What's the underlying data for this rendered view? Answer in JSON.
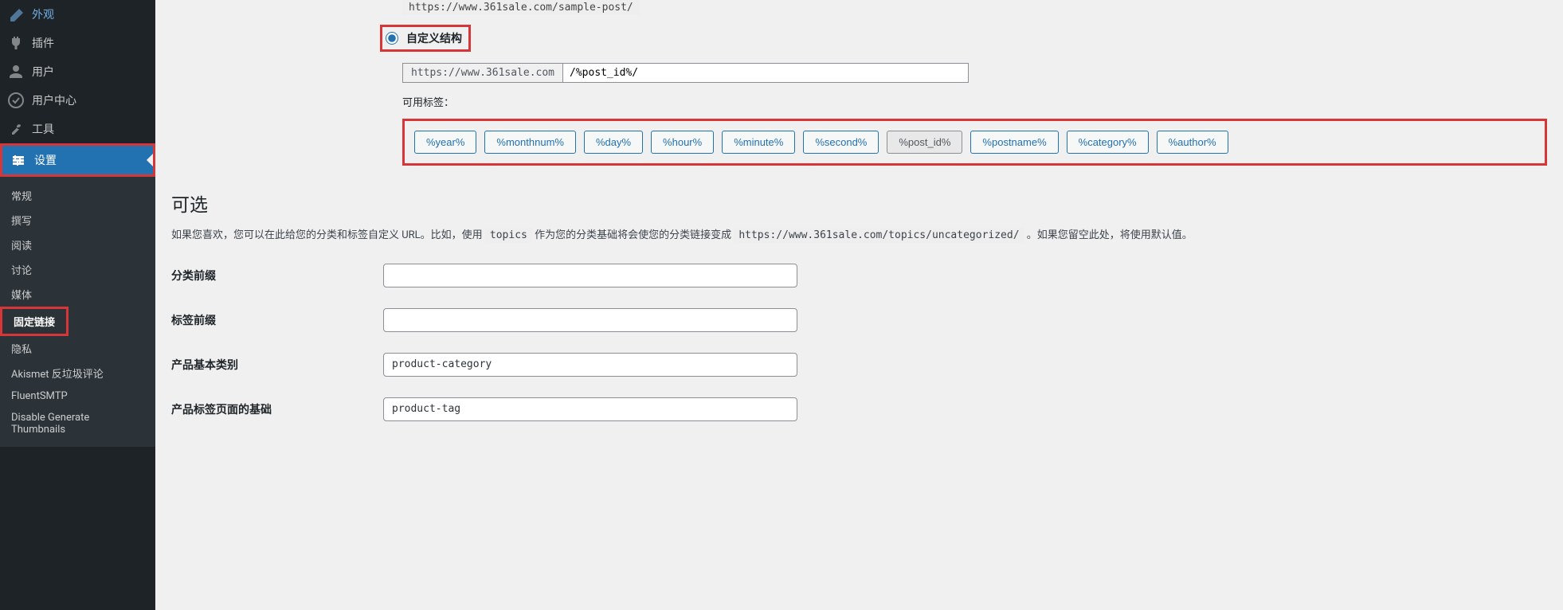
{
  "sidebar": {
    "main_items": [
      {
        "label": "外观",
        "icon": "appearance"
      },
      {
        "label": "插件",
        "icon": "plugins"
      },
      {
        "label": "用户",
        "icon": "users"
      },
      {
        "label": "用户中心",
        "icon": "usercenter"
      },
      {
        "label": "工具",
        "icon": "tools"
      },
      {
        "label": "设置",
        "icon": "settings"
      }
    ],
    "submenu": [
      {
        "label": "常规"
      },
      {
        "label": "撰写"
      },
      {
        "label": "阅读"
      },
      {
        "label": "讨论"
      },
      {
        "label": "媒体"
      },
      {
        "label": "固定链接"
      },
      {
        "label": "隐私"
      },
      {
        "label": "Akismet 反垃圾评论"
      },
      {
        "label": "FluentSMTP"
      },
      {
        "label": "Disable Generate Thumbnails"
      }
    ]
  },
  "partial_url": "https://www.361sale.com/sample-post/",
  "custom_structure": {
    "label": "自定义结构",
    "url_prefix": "https://www.361sale.com",
    "value": "/%post_id%/",
    "available_tags_label": "可用标签：",
    "tags": [
      "%year%",
      "%monthnum%",
      "%day%",
      "%hour%",
      "%minute%",
      "%second%",
      "%post_id%",
      "%postname%",
      "%category%",
      "%author%"
    ]
  },
  "optional": {
    "heading": "可选",
    "desc_prefix": "如果您喜欢，您可以在此给您的分类和标签自定义 URL。比如，使用 ",
    "desc_code1": "topics",
    "desc_mid": " 作为您的分类基础将会使您的分类链接变成 ",
    "desc_code2": "https://www.361sale.com/topics/uncategorized/",
    "desc_suffix": " 。如果您留空此处，将使用默认值。",
    "fields": [
      {
        "label": "分类前缀",
        "value": ""
      },
      {
        "label": "标签前缀",
        "value": ""
      },
      {
        "label": "产品基本类别",
        "value": "product-category"
      },
      {
        "label": "产品标签页面的基础",
        "value": "product-tag"
      }
    ]
  }
}
